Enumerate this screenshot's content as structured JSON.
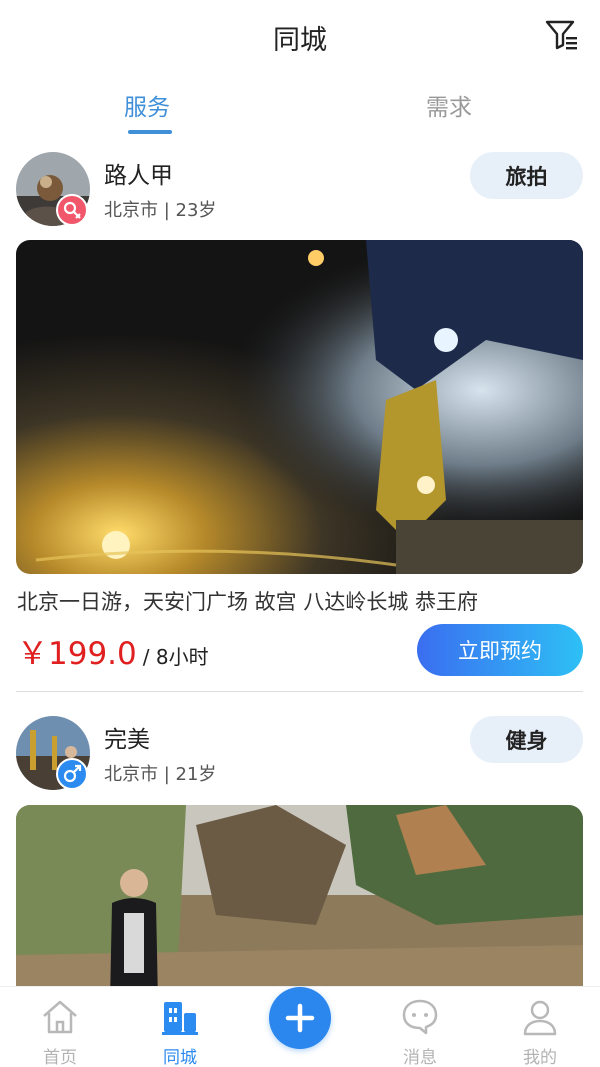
{
  "header": {
    "title": "同城",
    "filter_icon": "filter-icon"
  },
  "tabs": [
    {
      "label": "服务",
      "active": true
    },
    {
      "label": "需求",
      "active": false
    }
  ],
  "cards": [
    {
      "user_name": "路人甲",
      "meta": "北京市 | 23岁",
      "gender_icon": "female-icon",
      "tag": "旅拍",
      "description": "北京一日游，天安门广场 故宫 八达岭长城 恭王府",
      "price": "￥199.0",
      "unit": "/ 8小时",
      "book_label": "立即预约"
    },
    {
      "user_name": "完美",
      "meta": "北京市 | 21岁",
      "gender_icon": "male-icon",
      "tag": "健身"
    }
  ],
  "tabbar": [
    {
      "label": "首页",
      "icon": "home-icon",
      "active": false
    },
    {
      "label": "同城",
      "icon": "building-icon",
      "active": true
    },
    {
      "label": "",
      "icon": "plus-icon",
      "active": false
    },
    {
      "label": "消息",
      "icon": "message-icon",
      "active": false
    },
    {
      "label": "我的",
      "icon": "profile-icon",
      "active": false
    }
  ],
  "colors": {
    "accent": "#3f8fd9",
    "price": "#e02020",
    "female": "#f1566b",
    "male": "#2c8bf0",
    "tag_bg": "#e7eff9"
  }
}
